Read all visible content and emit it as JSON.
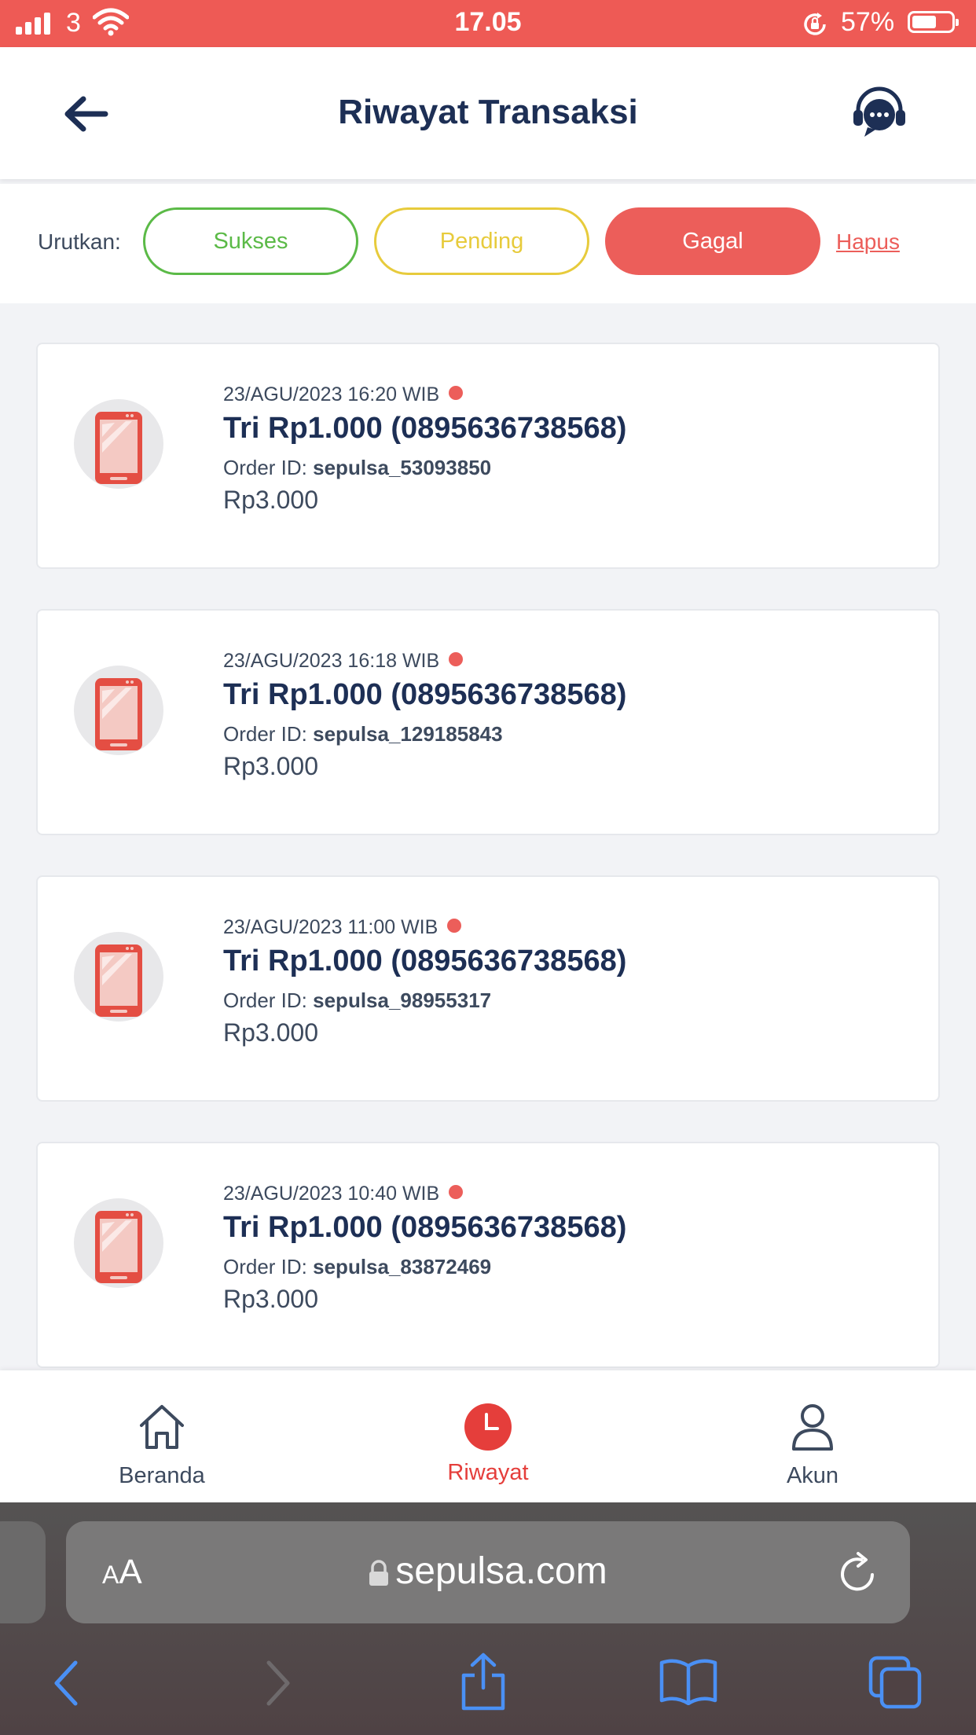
{
  "status_bar": {
    "carrier": "3",
    "time": "17.05",
    "battery": "57%"
  },
  "header": {
    "title": "Riwayat Transaksi"
  },
  "filter": {
    "label": "Urutkan:",
    "options": [
      "Sukses",
      "Pending",
      "Gagal"
    ],
    "selected": "Gagal",
    "clear_label": "Hapus"
  },
  "transactions": [
    {
      "date": "23/AGU/2023 16:20 WIB",
      "product": "Tri Rp1.000 (0895636738568)",
      "order_label": "Order ID: ",
      "order_id": "sepulsa_53093850",
      "price": "Rp3.000"
    },
    {
      "date": "23/AGU/2023 16:18 WIB",
      "product": "Tri Rp1.000 (0895636738568)",
      "order_label": "Order ID: ",
      "order_id": "sepulsa_129185843",
      "price": "Rp3.000"
    },
    {
      "date": "23/AGU/2023 11:00 WIB",
      "product": "Tri Rp1.000 (0895636738568)",
      "order_label": "Order ID: ",
      "order_id": "sepulsa_98955317",
      "price": "Rp3.000"
    },
    {
      "date": "23/AGU/2023 10:40 WIB",
      "product": "Tri Rp1.000 (0895636738568)",
      "order_label": "Order ID: ",
      "order_id": "sepulsa_83872469",
      "price": "Rp3.000"
    }
  ],
  "bottom_nav": {
    "items": [
      "Beranda",
      "Riwayat",
      "Akun"
    ],
    "active": "Riwayat"
  },
  "browser": {
    "aa_small": "A",
    "aa_large": "A",
    "url": "sepulsa.com"
  },
  "colors": {
    "accent": "#ec5e5a",
    "success": "#5bba47",
    "pending": "#e7cb3c",
    "navy": "#1d2f55"
  }
}
